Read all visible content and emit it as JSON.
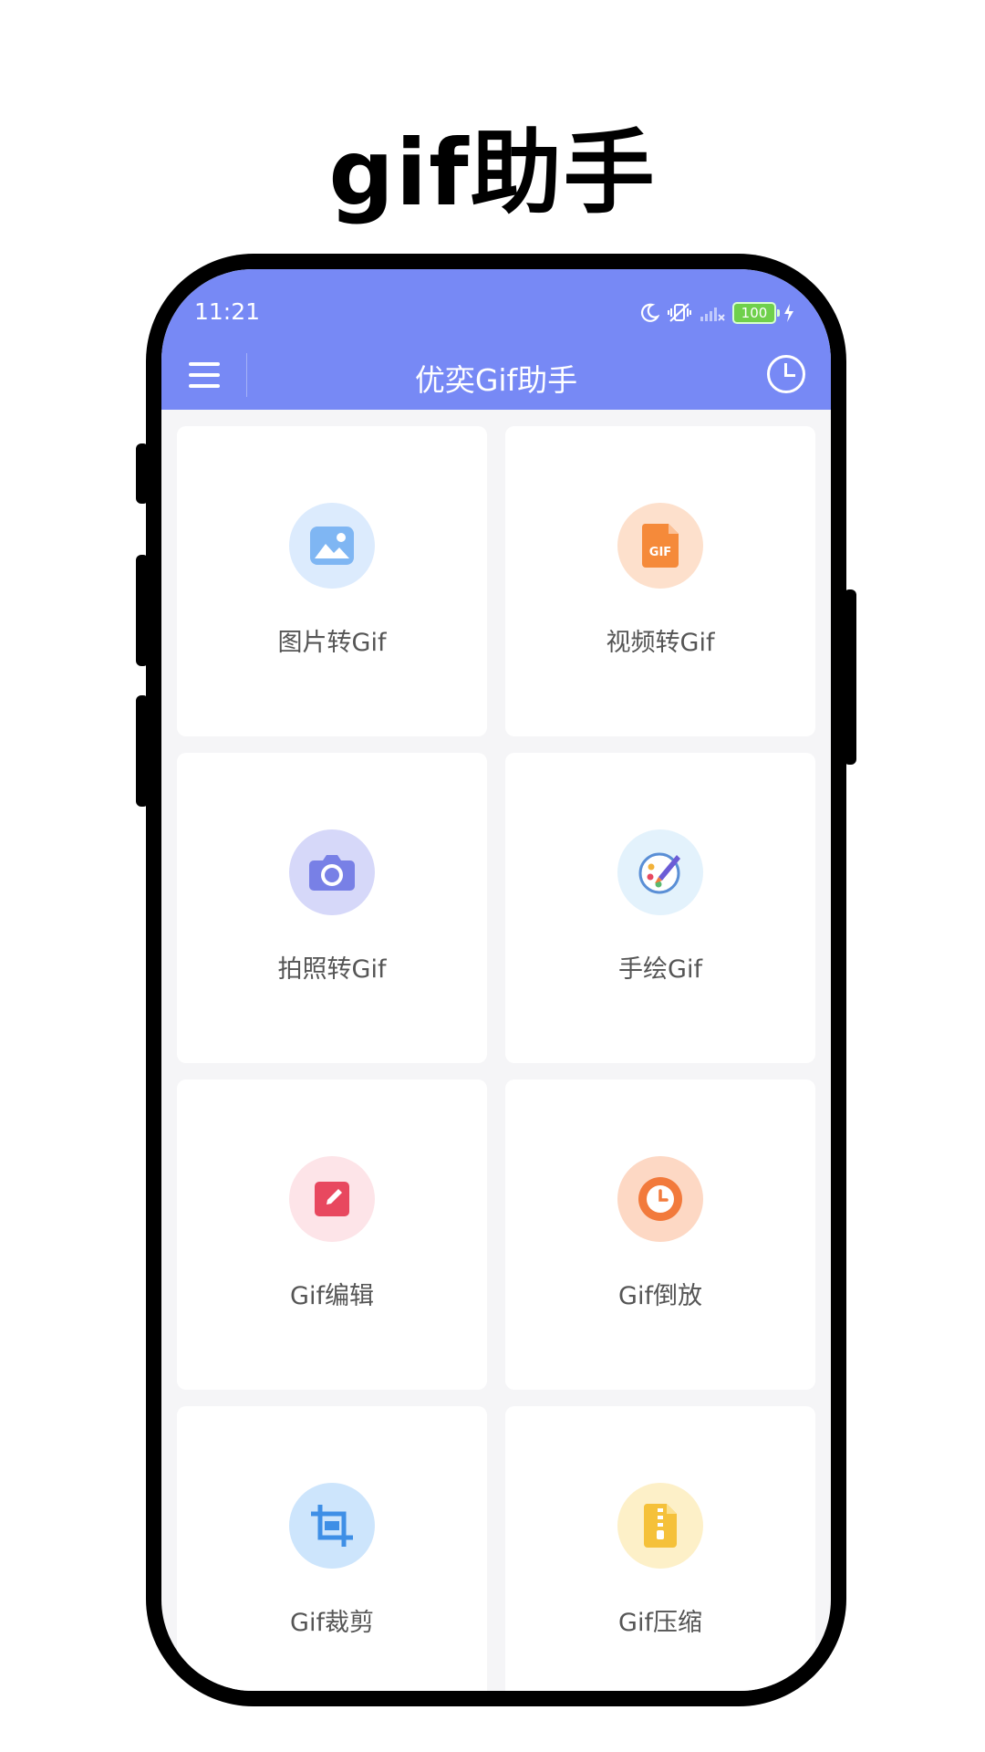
{
  "promo": {
    "title": "gif助手"
  },
  "status": {
    "time": "11:21",
    "battery": "100"
  },
  "toolbar": {
    "title": "优奕Gif助手"
  },
  "features": [
    {
      "label": "图片转Gif",
      "icon": "image-icon",
      "bg": "#dcebfd",
      "fg": "#6aaaf0"
    },
    {
      "label": "视频转Gif",
      "icon": "gif-file-icon",
      "bg": "#fde0cc",
      "fg": "#f58a3a",
      "icon_text": "GIF"
    },
    {
      "label": "拍照转Gif",
      "icon": "camera-icon",
      "bg": "#d6d8f9",
      "fg": "#7880e6"
    },
    {
      "label": "手绘Gif",
      "icon": "palette-icon",
      "bg": "#e3f2fc",
      "fg": "#5a8fd6"
    },
    {
      "label": "Gif编辑",
      "icon": "edit-icon",
      "bg": "#fde4e8",
      "fg": "#e8485f"
    },
    {
      "label": "Gif倒放",
      "icon": "clock-icon",
      "bg": "#fdd8c4",
      "fg": "#f27a3c"
    },
    {
      "label": "Gif裁剪",
      "icon": "crop-icon",
      "bg": "#cde5fc",
      "fg": "#3e8fe6"
    },
    {
      "label": "Gif压缩",
      "icon": "zip-icon",
      "bg": "#fdf0c8",
      "fg": "#f5c13a"
    }
  ]
}
